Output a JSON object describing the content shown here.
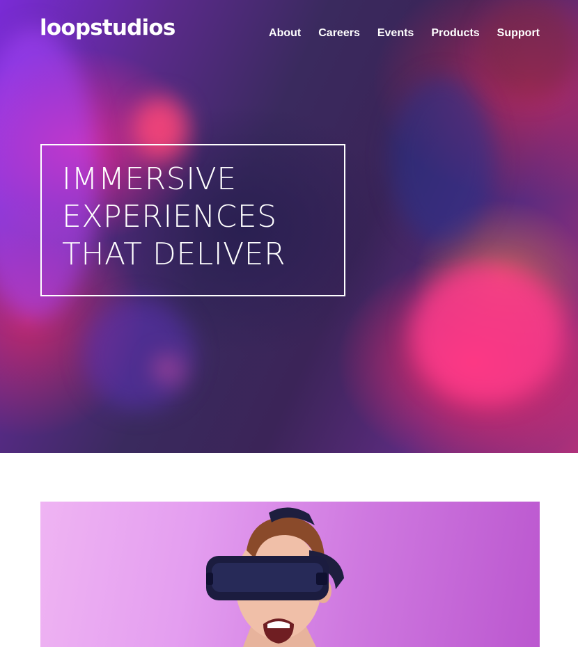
{
  "brand": {
    "logo": "loopstudios"
  },
  "nav": {
    "items": [
      "About",
      "Careers",
      "Events",
      "Products",
      "Support"
    ]
  },
  "hero": {
    "headline_lines": [
      "IMMERSIVE",
      "EXPERIENCES",
      "THAT DELIVER"
    ]
  },
  "colors": {
    "text_on_hero": "#ffffff",
    "page_bg": "#ffffff",
    "vr_bg_light": "#efb4f3",
    "vr_bg_dark": "#bb57cf"
  },
  "images": {
    "hero": "hero-photo-neon-vr",
    "vr": "man-wearing-vr-headset"
  }
}
